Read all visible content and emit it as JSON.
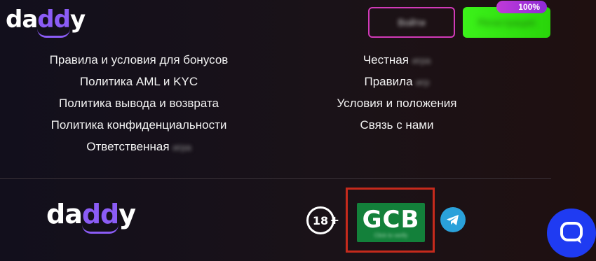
{
  "logo_text": "daddy",
  "header": {
    "login_label": "Войти",
    "register_label": "Регистрация",
    "badge": "100%"
  },
  "footer": {
    "left_links": [
      {
        "label": "Правила и условия для бонусов",
        "blurred": ""
      },
      {
        "label": "Политика AML и KYC",
        "blurred": ""
      },
      {
        "label": "Политика вывода и возврата",
        "blurred": ""
      },
      {
        "label": "Политика конфиденциальности",
        "blurred": ""
      },
      {
        "label": "Ответственная",
        "blurred": "игра"
      }
    ],
    "right_links": [
      {
        "label": "Честная",
        "blurred": "игра"
      },
      {
        "label": "Правила",
        "blurred": "игр"
      },
      {
        "label": "Условия и положения",
        "blurred": ""
      },
      {
        "label": "Связь с нами",
        "blurred": ""
      }
    ]
  },
  "badges": {
    "age": "18",
    "age_plus": "+",
    "gcb": "GCB",
    "gcb_sub": "Click to verify"
  },
  "colors": {
    "accent_purple": "#8b5cf6",
    "register_green": "#3cf21a",
    "login_border": "#d13ab8",
    "chat_blue": "#1f3bf2",
    "telegram_blue": "#2aa1da",
    "frame_red": "#c62a1c"
  },
  "icons": [
    "telegram-icon",
    "chat-icon"
  ]
}
